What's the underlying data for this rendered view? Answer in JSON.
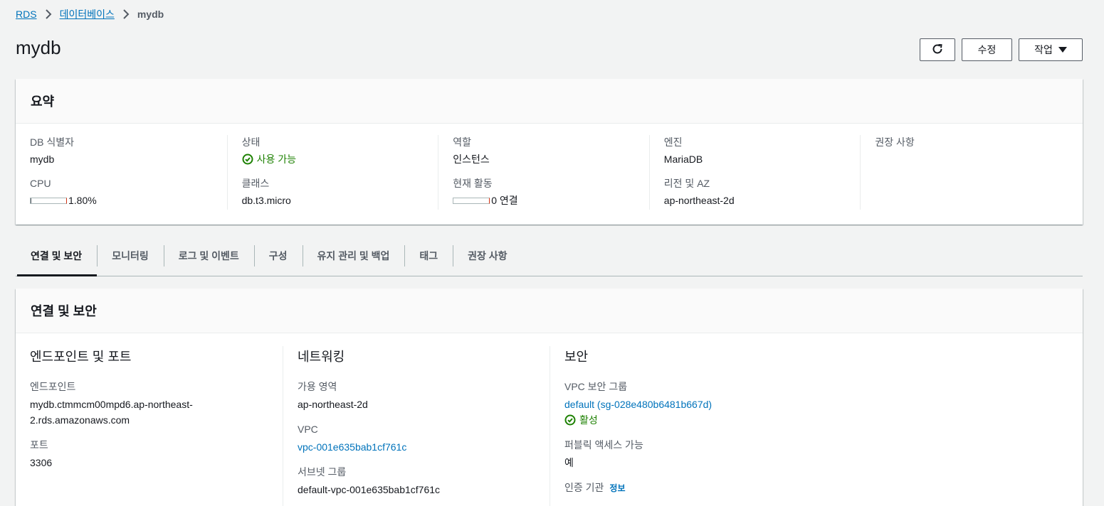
{
  "breadcrumb": {
    "items": [
      "RDS",
      "데이터베이스"
    ],
    "current": "mydb"
  },
  "page": {
    "title": "mydb"
  },
  "actions": {
    "modify": "수정",
    "actions": "작업"
  },
  "summary": {
    "title": "요약",
    "db_identifier_label": "DB 식별자",
    "db_identifier": "mydb",
    "cpu_label": "CPU",
    "cpu_value": "1.80%",
    "cpu_fraction": 0.018,
    "status_label": "상태",
    "status_value": "사용 가능",
    "class_label": "클래스",
    "class_value": "db.t3.micro",
    "role_label": "역할",
    "role_value": "인스턴스",
    "activity_label": "현재 활동",
    "activity_value": "0 연결",
    "activity_fraction": 0,
    "engine_label": "엔진",
    "engine_value": "MariaDB",
    "region_label": "리전 및 AZ",
    "region_value": "ap-northeast-2d",
    "recommendations_label": "권장 사항"
  },
  "tabs": [
    {
      "label": "연결 및 보안",
      "active": true
    },
    {
      "label": "모니터링"
    },
    {
      "label": "로그 및 이벤트"
    },
    {
      "label": "구성"
    },
    {
      "label": "유지 관리 및 백업"
    },
    {
      "label": "태그"
    },
    {
      "label": "권장 사항"
    }
  ],
  "connectivity": {
    "title": "연결 및 보안",
    "endpoint_section": {
      "heading": "엔드포인트 및 포트",
      "endpoint_label": "엔드포인트",
      "endpoint_line1": "mydb.ctmmcm00mpd6.ap-northeast-",
      "endpoint_line2": "2.rds.amazonaws.com",
      "port_label": "포트",
      "port_value": "3306"
    },
    "network_section": {
      "heading": "네트워킹",
      "az_label": "가용 영역",
      "az_value": "ap-northeast-2d",
      "vpc_label": "VPC",
      "vpc_value": "vpc-001e635bab1cf761c",
      "subnet_label": "서브넷 그룹",
      "subnet_value": "default-vpc-001e635bab1cf761c"
    },
    "security_section": {
      "heading": "보안",
      "sg_label": "VPC 보안 그룹",
      "sg_value": "default (sg-028e480b6481b667d)",
      "sg_status": "활성",
      "public_label": "퍼블릭 액세스 가능",
      "public_value": "예",
      "ca_label": "인증 기관",
      "ca_info": "정보"
    }
  },
  "colors": {
    "link": "#0073bb",
    "success": "#1d8102",
    "text": "#16191f",
    "muted": "#545b64"
  }
}
